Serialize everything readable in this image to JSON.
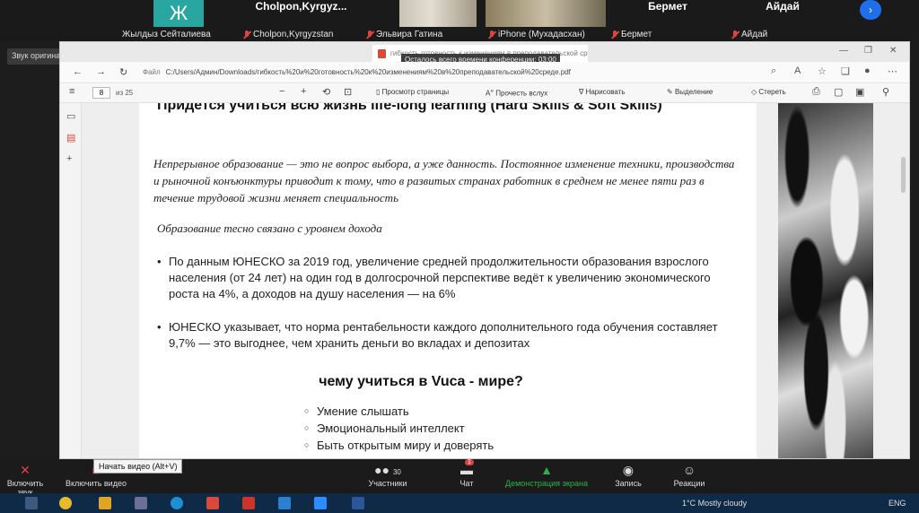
{
  "zoom": {
    "participants": [
      {
        "name": "Жылдыз Сейталиева",
        "initial": "Ж"
      },
      {
        "name": "Cholpon,Kyrgyzstan",
        "top_label": "Cholpon,Kyrgyz..."
      },
      {
        "name": "Эльвира Гатина"
      },
      {
        "name": "iPhone (Мухадасхан)"
      },
      {
        "name": "Бермет",
        "top_label": "Бермет"
      },
      {
        "name": "Айдай",
        "top_label": "Айдай"
      }
    ],
    "audio_chip": "Звук оригинала: выкл.",
    "controls": {
      "mute": "Включить звук",
      "video": "Включить видео",
      "video_tooltip": "Начать видео (Alt+V)",
      "participants": "Участники",
      "participants_count": "30",
      "chat": "Чат",
      "chat_badge": "1",
      "share": "Демонстрация экрана",
      "record": "Запись",
      "reactions": "Реакции"
    },
    "timer_tip": "Осталось всего времени конференции: 03:00"
  },
  "browser": {
    "tab_title": "гибкость готовность к изменениям в преподавательской среде.pdf",
    "url_label": "Файл",
    "url": "C:/Users/Админ/Downloads/гибкость%20и%20готовность%20к%20изменениям%20в%20преподавательской%20среде.pdf",
    "pdf_toolbar": {
      "page": "8",
      "of": "из 25",
      "view_page": "Просмотр страницы",
      "read_aloud": "Прочесть вслух",
      "draw": "Нарисовать",
      "highlight": "Выделение",
      "erase": "Стереть"
    }
  },
  "slide": {
    "headline": "Придется учиться всю жизнь life-long learning (Hard Skills & Soft Skills)",
    "intro": "Непрерывное образование — это не вопрос выбора, а уже данность. Постоянное изменение техники, производства и рыночной конъюнктуры приводит к тому, что в развитых странах работник в среднем не менее пяти раз в течение трудовой жизни меняет специальность",
    "income_note": "Образование тесно связано с уровнем дохода",
    "bullets": [
      "По данным ЮНЕСКО за 2019 год, увеличение средней продолжительности образования взрослого населения (от 24 лет) на один год в долгосрочной перспективе ведёт к увеличению экономического роста на 4%, а доходов на душу населения — на 6%",
      "ЮНЕСКО указывает, что норма рентабельности каждого дополнительного года обучения составляет 9,7% — это выгоднее, чем хранить деньги во вкладах и депозитах"
    ],
    "subheading": "чему учиться в Vuca - мире?",
    "skills": [
      "Умение слышать",
      "Эмоциональный интеллект",
      "Быть открытым миру и доверять"
    ]
  },
  "taskbar": {
    "weather": "1°C  Mostly cloudy",
    "lang": "ENG"
  }
}
